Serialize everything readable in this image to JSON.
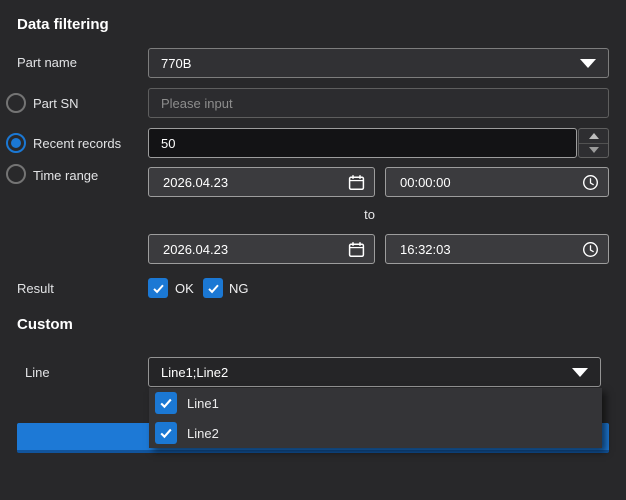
{
  "filtering": {
    "title": "Data filtering",
    "part_name": {
      "label": "Part name",
      "value": "770B"
    },
    "part_sn": {
      "label": "Part SN",
      "placeholder": "Please input",
      "selected": false
    },
    "recent_records": {
      "label": "Recent records",
      "value": "50",
      "selected": true
    },
    "time_range": {
      "label": "Time range",
      "selected": false,
      "start_date": "2026.04.23",
      "start_time": "00:00:00",
      "to_label": "to",
      "end_date": "2026.04.23",
      "end_time": "16:32:03"
    },
    "result": {
      "label": "Result",
      "options": [
        {
          "label": "OK",
          "checked": true
        },
        {
          "label": "NG",
          "checked": true
        }
      ]
    }
  },
  "custom": {
    "title": "Custom",
    "line": {
      "label": "Line",
      "value": "Line1;Line2",
      "dropdown_open": true,
      "options": [
        {
          "label": "Line1",
          "checked": true
        },
        {
          "label": "Line2",
          "checked": true
        }
      ]
    }
  },
  "colors": {
    "accent": "#1b78d4",
    "background": "#28282a",
    "field_bg": "#3b3b3e"
  }
}
